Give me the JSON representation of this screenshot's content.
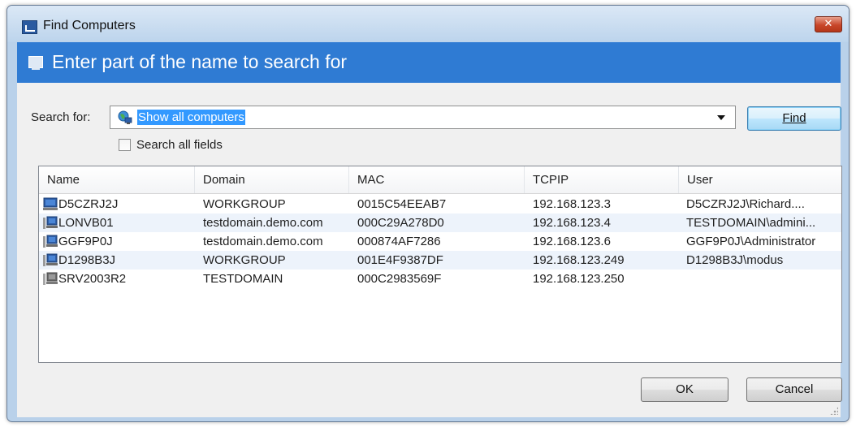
{
  "window": {
    "title": "Find Computers",
    "close_label": "✕"
  },
  "banner": {
    "text": "Enter part of the name to search for"
  },
  "search": {
    "label": "Search for:",
    "value": "Show all computers",
    "find_button": "Find"
  },
  "options": {
    "search_all_fields_label": "Search all fields",
    "search_all_fields_checked": false
  },
  "table": {
    "columns": [
      "Name",
      "Domain",
      "MAC",
      "TCPIP",
      "User"
    ],
    "rows": [
      {
        "name": "D5CZRJ2J",
        "domain": "WORKGROUP",
        "mac": "0015C54EEAB7",
        "tcpip": "192.168.123.3",
        "user": "D5CZRJ2J\\Richard....",
        "icon": "desktop-computer-icon"
      },
      {
        "name": "LONVB01",
        "domain": "testdomain.demo.com",
        "mac": "000C29A278D0",
        "tcpip": "192.168.123.4",
        "user": "TESTDOMAIN\\admini...",
        "icon": "networked-computer-icon"
      },
      {
        "name": "GGF9P0J",
        "domain": "testdomain.demo.com",
        "mac": "000874AF7286",
        "tcpip": "192.168.123.6",
        "user": "GGF9P0J\\Administrator",
        "icon": "networked-computer-icon"
      },
      {
        "name": "D1298B3J",
        "domain": "WORKGROUP",
        "mac": "001E4F9387DF",
        "tcpip": "192.168.123.249",
        "user": "D1298B3J\\modus",
        "icon": "networked-computer-icon"
      },
      {
        "name": "SRV2003R2",
        "domain": "TESTDOMAIN",
        "mac": "000C2983569F",
        "tcpip": "192.168.123.250",
        "user": "",
        "icon": "offline-computer-icon"
      }
    ]
  },
  "footer": {
    "ok_label": "OK",
    "cancel_label": "Cancel"
  },
  "colors": {
    "banner": "#2f7bd3",
    "selection": "#3399ff",
    "alt_row": "#edf3fb"
  }
}
